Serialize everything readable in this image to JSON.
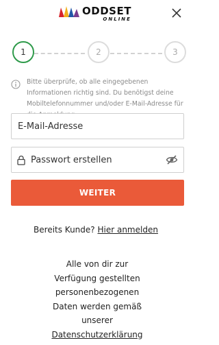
{
  "header": {
    "logo_word": "ODDSET",
    "logo_sub": "ONLINE",
    "colors": {
      "logo_red": "#d6242c",
      "logo_yellow": "#f2b01e",
      "logo_blue": "#2357a8",
      "logo_purple": "#7a3c8f"
    }
  },
  "stepper": {
    "current_step": 1,
    "steps": [
      "1",
      "2",
      "3"
    ],
    "colors": {
      "active": "#2e9a4a",
      "inactive": "#dcdcdc"
    }
  },
  "info": {
    "icon": "info-icon",
    "text": "Bitte überprüfe, ob alle eingegebenen Informationen richtig sind. Du benötigst deine Mobiltelefonnummer und/oder E-Mail-Adresse für die Anmeldung."
  },
  "form": {
    "email_placeholder": "E-Mail-Adresse",
    "email_value": "",
    "password_placeholder": "Passwort erstellen",
    "password_value": "",
    "submit_label": "WEITER",
    "submit_color": "#ea5a39"
  },
  "login": {
    "prompt": "Bereits Kunde?",
    "link": "Hier anmelden"
  },
  "privacy": {
    "lines": [
      "Alle von dir zur",
      "Verfügung gestellten",
      "personenbezogenen",
      "Daten werden gemäß",
      "unserer"
    ],
    "link": "Datenschutzerklärung"
  }
}
